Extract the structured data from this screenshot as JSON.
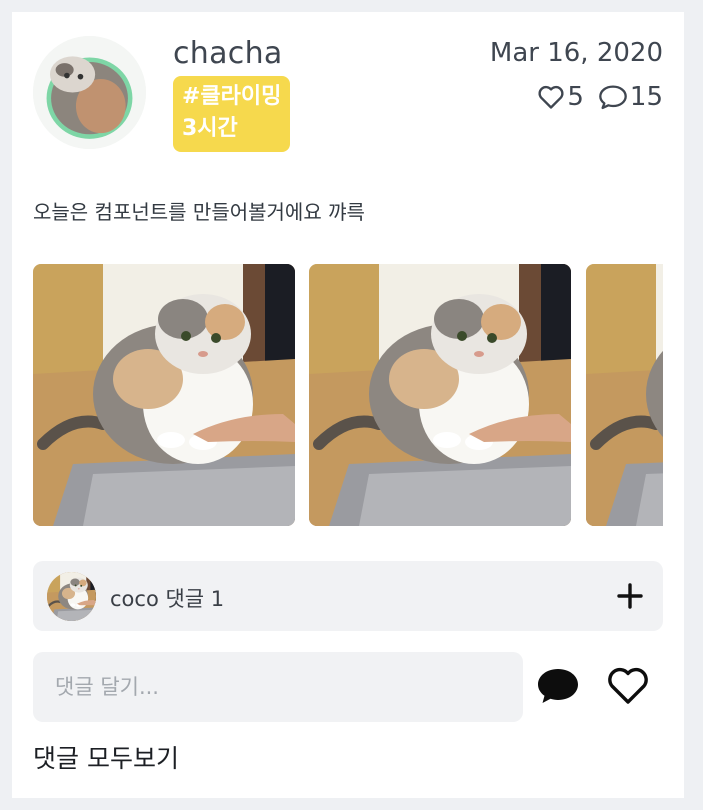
{
  "post": {
    "username": "chacha",
    "tag_line1": "#클라이밍",
    "tag_line2": "3시간",
    "date": "Mar 16, 2020",
    "likes": "5",
    "comments": "15",
    "caption": "오늘은 컴포넌트를 만들어볼거에요 꺄륵"
  },
  "gallery": {
    "photos": [
      "cat-photo",
      "cat-photo",
      "cat-photo"
    ]
  },
  "comment_preview": {
    "text": "coco 댓글 1"
  },
  "comment_input": {
    "placeholder": "댓글 달기..."
  },
  "footer": {
    "view_all_label": "댓글 모두보기"
  },
  "colors": {
    "tag_bg": "#f6d94d",
    "card_bg": "#ffffff",
    "page_bg": "#eef0f3",
    "input_bg": "#f1f2f4"
  }
}
